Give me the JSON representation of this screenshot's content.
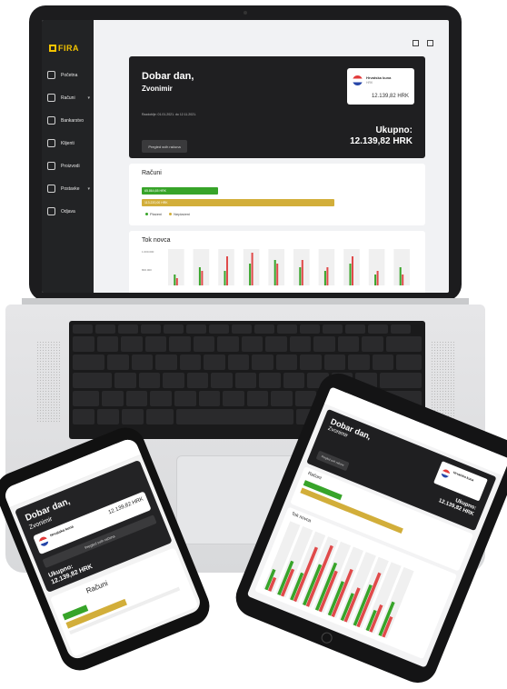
{
  "brand": {
    "name": "FIRA",
    "accent": "#f2c200"
  },
  "laptop": {
    "sidebar": {
      "items": [
        {
          "label": "Početna",
          "icon": "home-icon"
        },
        {
          "label": "Računi",
          "icon": "document-icon",
          "caret": "▾"
        },
        {
          "label": "Bankarstvo",
          "icon": "bank-icon"
        },
        {
          "label": "Klijenti",
          "icon": "contacts-icon"
        },
        {
          "label": "Proizvodi",
          "icon": "box-icon"
        },
        {
          "label": "Postavke",
          "icon": "settings-icon",
          "caret": "▾"
        },
        {
          "label": "Odjava",
          "icon": "logout-icon"
        }
      ]
    },
    "hero": {
      "greeting": "Dobar dan,",
      "name": "Zvonimir",
      "period": "Razdoblje: 01.01.2021. do 12.11.2021.",
      "button": "Pregled svih računa",
      "account": {
        "name": "Hrvatska kuna",
        "currency": "HRK",
        "amount": "12.139,82 HRK"
      },
      "total_label": "Ukupno:",
      "total_amount": "12.139,82 HRK"
    },
    "invoices": {
      "title": "Računi",
      "paid_amount": "65.864,65 HRK",
      "unpaid_amount": "113.220,00 HRK",
      "legend_paid": "Plaćeni",
      "legend_unpaid": "Neplaćeni",
      "colors": {
        "paid": "#37a429",
        "unpaid": "#d2ae3a"
      }
    },
    "cashflow": {
      "title": "Tok novca",
      "y_labels": [
        "1.000.000",
        "800.000"
      ]
    }
  },
  "phone": {
    "greeting": "Dobar dan,",
    "name": "Zvonimir",
    "account_name": "Hrvatska kuna",
    "account_amount": "12.139,82 HRK",
    "button": "Pregled svih računa",
    "total_label": "Ukupno:",
    "total_amount": "12.139,82 HRK",
    "invoices_title": "Računi"
  },
  "tablet": {
    "greeting": "Dobar dan,",
    "name": "Zvonimir",
    "account_name": "Hrvatska kuna",
    "button": "Pregled svih računa",
    "total_label": "Ukupno:",
    "total_amount": "12.139,82 HRK",
    "invoices_title": "Računi",
    "cashflow_title": "Tok novca"
  },
  "chart_data": {
    "type": "bar",
    "title": "Tok novca",
    "categories": [
      "1",
      "2",
      "3",
      "4",
      "5",
      "6",
      "7",
      "8",
      "9",
      "10"
    ],
    "series": [
      {
        "name": "Plaćeni",
        "color": "#37a429",
        "values": [
          3,
          5,
          4,
          6,
          7,
          5,
          4,
          6,
          3,
          5
        ]
      },
      {
        "name": "Neplaćeni",
        "color": "#e04a4a",
        "values": [
          2,
          4,
          8,
          9,
          6,
          7,
          5,
          8,
          4,
          3
        ]
      }
    ]
  }
}
